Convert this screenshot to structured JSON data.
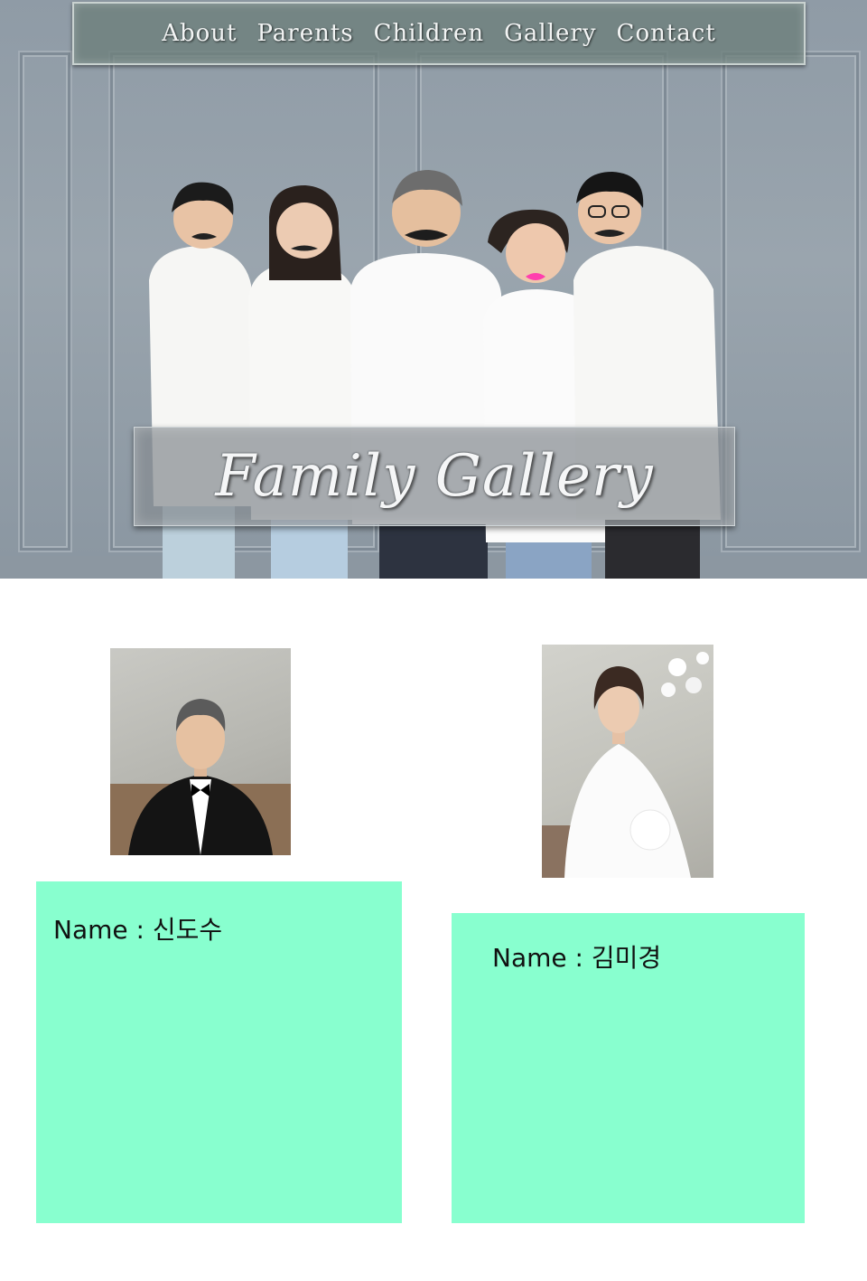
{
  "nav": {
    "items": [
      {
        "label": "About"
      },
      {
        "label": "Parents"
      },
      {
        "label": "Children"
      },
      {
        "label": "Gallery"
      },
      {
        "label": "Contact"
      }
    ]
  },
  "hero": {
    "title": "Family Gallery"
  },
  "parents": {
    "father": {
      "name_label": "Name : 신도수"
    },
    "mother": {
      "name_label": "Name : 김미경"
    }
  },
  "colors": {
    "card_background": "#88ffcf",
    "nav_background": "#6e807d",
    "hero_wall": "#97a3ad"
  }
}
